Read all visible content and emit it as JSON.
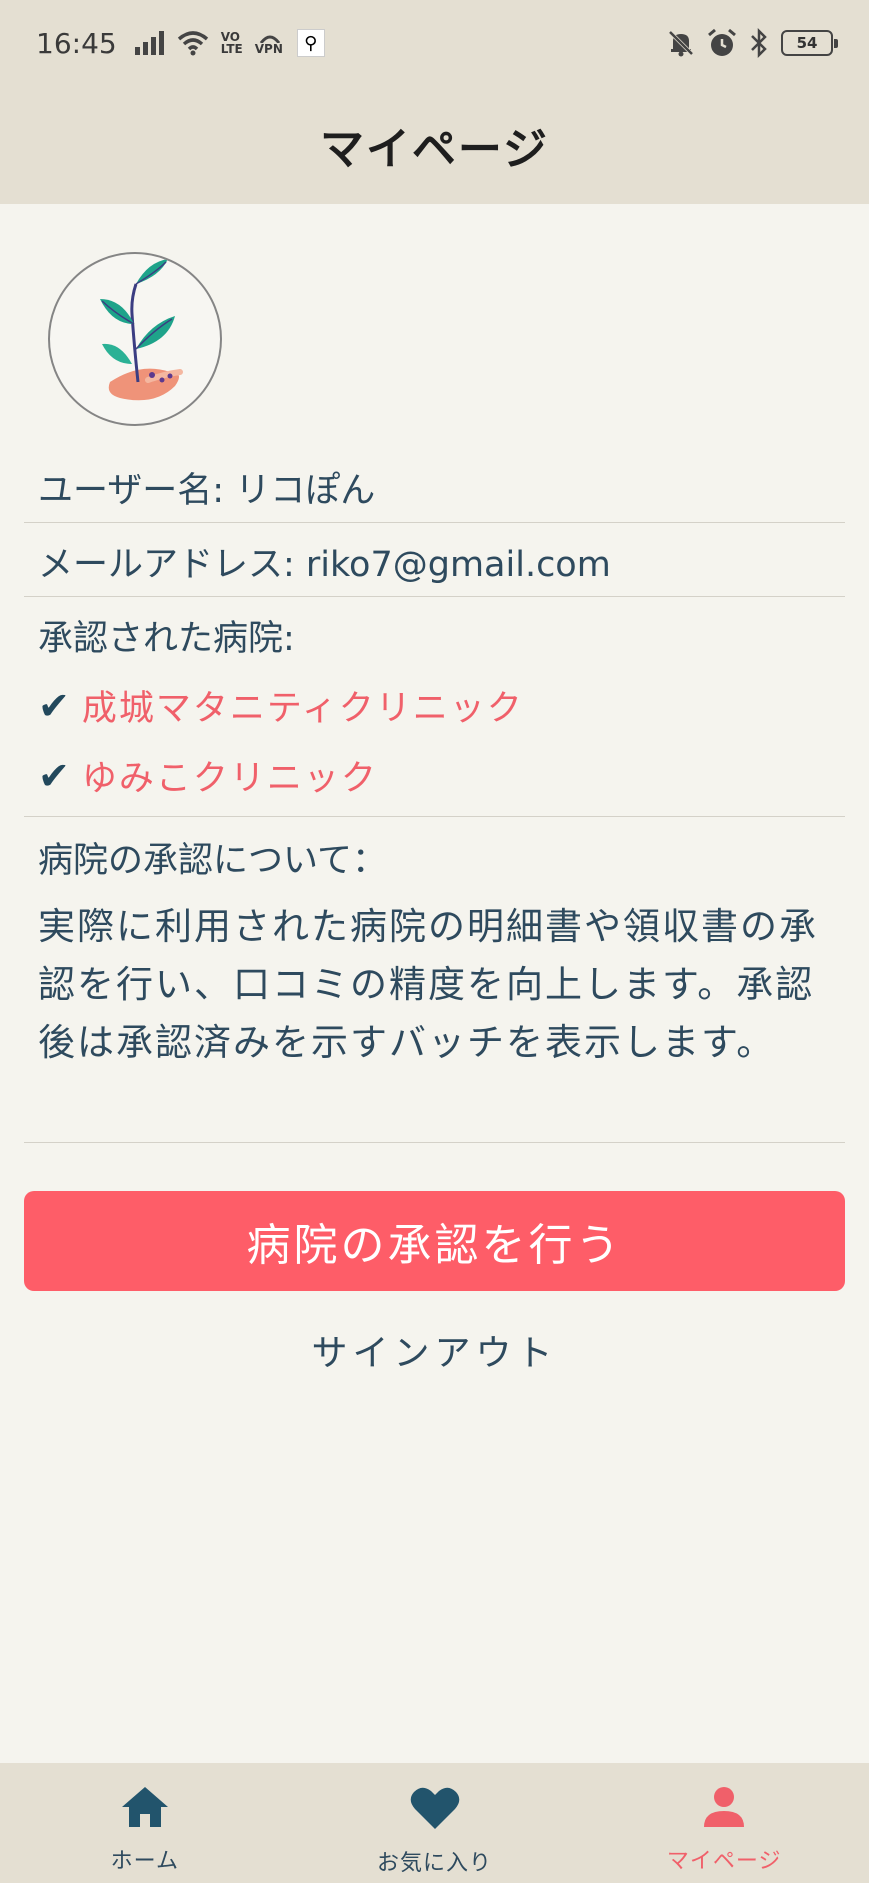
{
  "status_bar": {
    "time": "16:45",
    "signal_icon": "signal-bars-icon",
    "wifi_icon": "wifi-icon",
    "volte_label_top": "VO",
    "volte_label_bottom": "LTE",
    "vpn_label": "VPN",
    "notifications_off_icon": "bell-off-icon",
    "alarm_icon": "alarm-icon",
    "bluetooth_icon": "bluetooth-icon",
    "battery": "54"
  },
  "header": {
    "title": "マイページ"
  },
  "profile": {
    "avatar_icon": "plant-in-hand-icon",
    "username": "ユーザー名: リコぽん",
    "email": "メールアドレス: riko7@gmail.com",
    "approved_hospitals_label": "承認された病院:",
    "approved_hospitals": [
      {
        "check": "✔",
        "name": "成城マタニティクリニック"
      },
      {
        "check": "✔",
        "name": "ゆみこクリニック"
      }
    ],
    "about_title": "病院の承認について：",
    "about_body": "実際に利用された病院の明細書や領収書の承認を行い、口コミの精度を向上します。承認後は承認済みを示すバッチを表示します。"
  },
  "actions": {
    "approve_button": "病院の承認を行う",
    "signout": "サインアウト"
  },
  "bottom_nav": {
    "items": [
      {
        "label": "ホーム",
        "icon": "home-icon",
        "active": false
      },
      {
        "label": "お気に入り",
        "icon": "heart-icon",
        "active": false
      },
      {
        "label": "マイページ",
        "icon": "person-icon",
        "active": true
      }
    ]
  },
  "colors": {
    "accent": "#fe5d68",
    "hospital_text": "#f0606a",
    "primary_text": "#2e4a5e",
    "bar_background": "#e4dfd2",
    "page_background": "#f5f4ee"
  }
}
